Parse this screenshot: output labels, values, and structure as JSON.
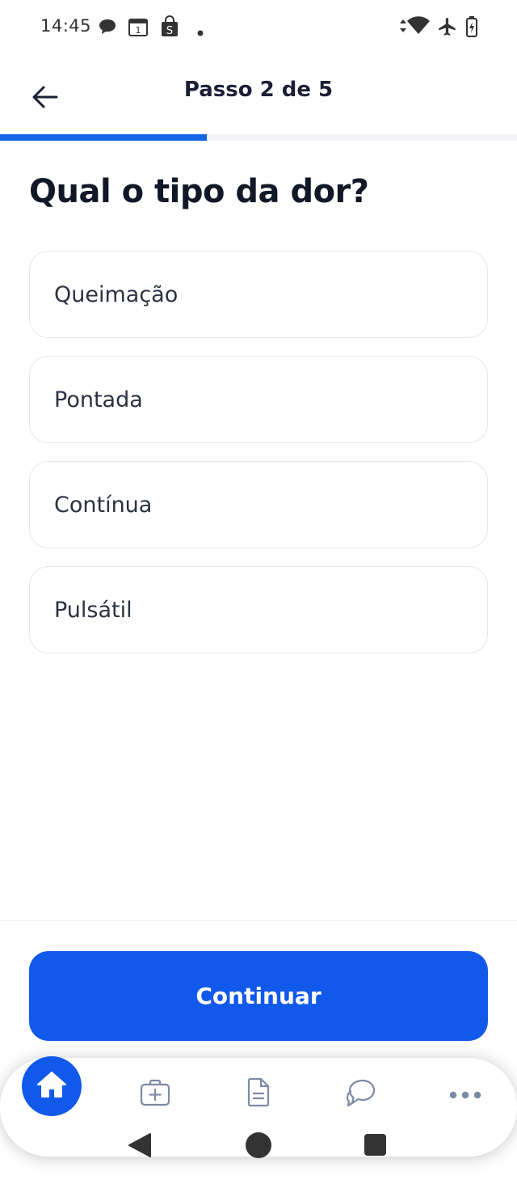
{
  "status_bar": {
    "time": "14:45",
    "left_icons": [
      "chat-bubble-icon",
      "calendar-icon",
      "shopping-bag-icon",
      "dot-icon"
    ],
    "right_icons": [
      "data-arrows-icon",
      "wifi-icon",
      "airplane-icon",
      "battery-icon"
    ]
  },
  "header": {
    "title": "Passo 2 de 5",
    "back_icon": "arrow-left-icon"
  },
  "progress": {
    "current_step": 2,
    "total_steps": 5,
    "fraction": 0.4
  },
  "question": {
    "title": "Qual o tipo da dor?"
  },
  "options": [
    {
      "label": "Queimação"
    },
    {
      "label": "Pontada"
    },
    {
      "label": "Contínua"
    },
    {
      "label": "Pulsátil"
    }
  ],
  "continue_button": {
    "label": "Continuar"
  },
  "bottom_nav": {
    "items": [
      {
        "icon": "home-icon",
        "active": true
      },
      {
        "icon": "medical-kit-icon",
        "active": false
      },
      {
        "icon": "document-icon",
        "active": false
      },
      {
        "icon": "chat-icon",
        "active": false
      },
      {
        "icon": "more-icon",
        "active": false
      }
    ]
  },
  "colors": {
    "accent": "#1159ea",
    "progress_fill": "#1565e8",
    "progress_track": "#f2f4f7",
    "option_border": "#e5e7eb",
    "nav_icon_inactive": "#7d8aa3"
  }
}
